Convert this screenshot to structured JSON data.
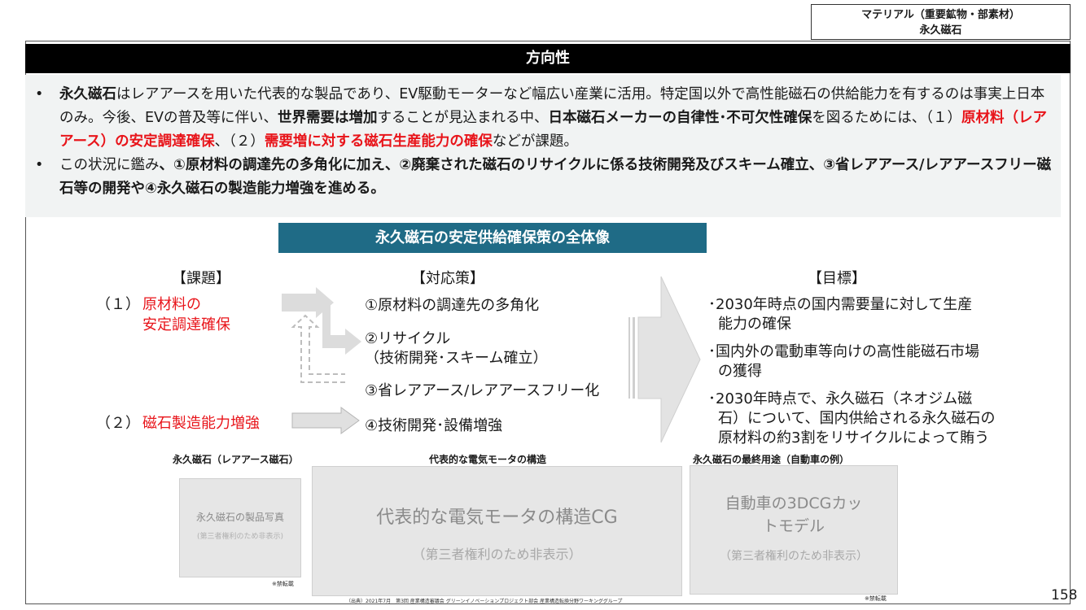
{
  "tag": {
    "line1": "マテリアル（重要鉱物・部素材）",
    "line2": "永久磁石"
  },
  "banner": {
    "title": "方向性"
  },
  "summary": {
    "bullet": "•",
    "p1": {
      "s1": "永久磁石",
      "s2": "はレアアースを用いた代表的な製品であり、EV駆動モーターなど幅広い産業に活用。特定国以外で高性能磁石の供給能力を有するのは事実上日本のみ。今後、EVの普及等に伴い、",
      "s3": "世界需要は増加",
      "s4": "することが見込まれる中、",
      "s5": "日本磁石メーカーの自律性･不可欠性確保",
      "s6": "を図るためには、（１）",
      "s7": "原材料（レアアース）の安定調達確保",
      "s8": "、（２）",
      "s9": "需要増に対する磁石生産能力の確保",
      "s10": "などが課題。"
    },
    "p2": {
      "s1": "この状況に鑑み",
      "s2": "、①原材料の調達先の多角化に加え、②廃棄された磁石のリサイクルに係る技術開発及びスキーム確立、③省レアアース/レアアースフリー磁石等の開発や④永久磁石の製造能力増強を進める。"
    }
  },
  "diagram": {
    "title": "永久磁石の安定供給確保策の全体像",
    "issues_header": "【課題】",
    "measures_header": "【対応策】",
    "goals_header": "【目標】",
    "issue1_num": "（１）",
    "issue1_line1": "原材料の",
    "issue1_line2": "安定調達確保",
    "issue2_num": "（２）",
    "issue2_text": "磁石製造能力増強",
    "measure1": "①原材料の調達先の多角化",
    "measure2_line1": "②リサイクル",
    "measure2_line2": "（技術開発･スキーム確立）",
    "measure3": "③省レアアース/レアアースフリー化",
    "measure4": "④技術開発･設備増強",
    "goal1_line1": "･2030年時点の国内需要量に対して生産",
    "goal1_line2": "能力の確保",
    "goal2_line1": "･国内外の電動車等向けの高性能磁石市場",
    "goal2_line2": "の獲得",
    "goal3_line1": "･2030年時点で、永久磁石（ネオジム磁",
    "goal3_line2": "石）について、国内供給される永久磁石の",
    "goal3_line3": "原材料の約3割をリサイクルによって賄う"
  },
  "images": {
    "img1_header": "永久磁石（レアアース磁石）",
    "img1_title": "永久磁石の製品写真",
    "img1_note": "(第三者権利のため非表示)",
    "img1_caption": "※禁転載",
    "img2_header": "代表的な電気モータの構造",
    "img2_title": "代表的な電気モータの構造CG",
    "img2_note": "（第三者権利のため非表示）",
    "img3_header": "永久磁石の最終用途（自動車の例）",
    "img3_title_line1": "自動車の3DCGカッ",
    "img3_title_line2": "トモデル",
    "img3_note": "（第三者権利のため非表示）",
    "img3_caption": "※禁転載",
    "source": "（出典）2021年7月　第3回 産業構造審議会 グリーンイノベーションプロジェクト部会 産業構造転換分野ワーキンググループ"
  },
  "page_number": "158"
}
